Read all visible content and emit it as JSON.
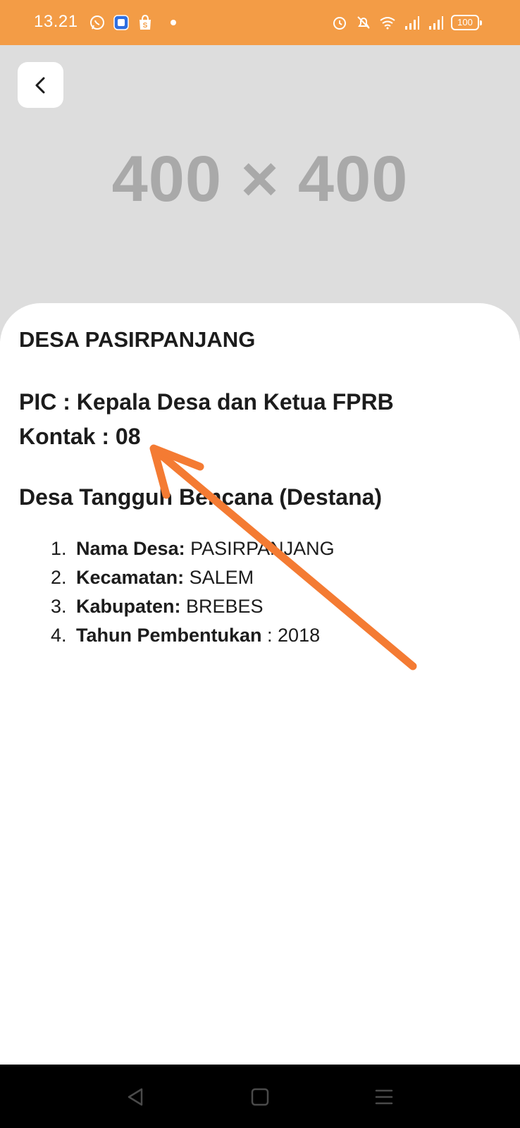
{
  "status_bar": {
    "time": "13.21",
    "left_icons": [
      "whatsapp-icon",
      "app-icon",
      "shopee-icon",
      "notification-dot"
    ],
    "right_icons": [
      "alarm-icon",
      "mute-icon",
      "wifi-icon",
      "signal-icon",
      "signal-icon"
    ],
    "battery": "100"
  },
  "hero": {
    "placeholder_text": "400 × 400"
  },
  "detail": {
    "village_title": "DESA PASIRPANJANG",
    "pic": "PIC : Kepala Desa dan Ketua FPRB",
    "contact": "Kontak : 08",
    "destana_heading": "Desa Tangguh Bencana (Destana)",
    "items": [
      {
        "num": "1.",
        "label": "Nama Desa:",
        "value": " PASIRPANJANG"
      },
      {
        "num": "2.",
        "label": "Kecamatan:",
        "value": " SALEM"
      },
      {
        "num": "3.",
        "label": "Kabupaten:",
        "value": " BREBES"
      },
      {
        "num": "4.",
        "label": "Tahun Pembentukan",
        "value": " : 2018"
      }
    ]
  },
  "colors": {
    "status_bar": "#f39c46",
    "hero_bg": "#dddddd",
    "annotation_arrow": "#f47b33"
  }
}
